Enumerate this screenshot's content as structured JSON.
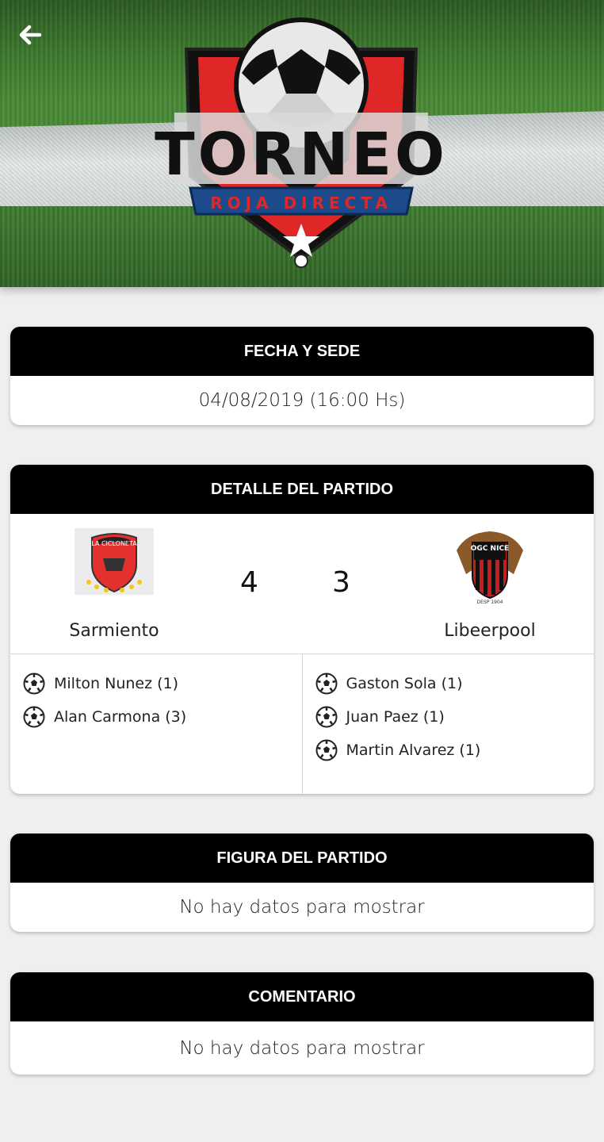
{
  "header": {
    "back_icon": "arrow-left-icon",
    "logo_title": "TORNEO",
    "logo_subtitle": "ROJA DIRECTA"
  },
  "fecha_sede": {
    "title": "FECHA Y SEDE",
    "value": "04/08/2019 (16:00 Hs)"
  },
  "detalle": {
    "title": "DETALLE DEL PARTIDO",
    "home": {
      "name": "Sarmiento",
      "score": "4",
      "logo_text": "LA CICLONETA"
    },
    "away": {
      "name": "Libeerpool",
      "score": "3",
      "logo_text": "OGC NICE",
      "logo_sub": "DESP 1904"
    },
    "home_scorers": [
      {
        "text": "Milton Nunez (1)"
      },
      {
        "text": "Alan Carmona (3)"
      }
    ],
    "away_scorers": [
      {
        "text": "Gaston Sola (1)"
      },
      {
        "text": "Juan Paez (1)"
      },
      {
        "text": "Martin Alvarez (1)"
      }
    ]
  },
  "figura": {
    "title": "FIGURA DEL PARTIDO",
    "value": "No hay datos para mostrar"
  },
  "comentario": {
    "title": "COMENTARIO",
    "value": "No hay datos para mostrar"
  },
  "colors": {
    "card_header": "#000000",
    "background": "#efefef",
    "crest_red": "#e02727",
    "crest_blue": "#1c4a8a"
  }
}
